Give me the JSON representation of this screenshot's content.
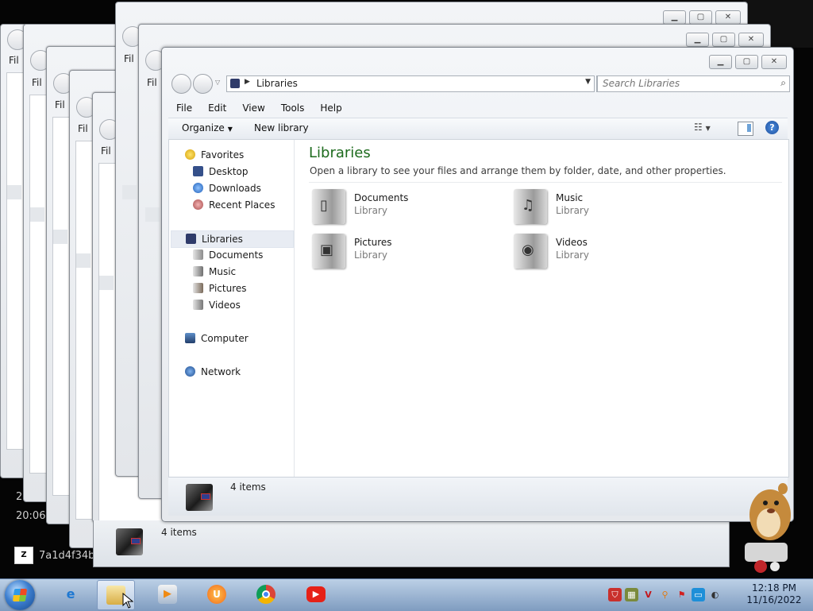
{
  "desktop": {
    "left_text_1": "2022",
    "left_text_2": "20:06",
    "shortcut_label": "7a1d4f34be",
    "shortcut_badge": "Z"
  },
  "background_windows": {
    "menu_stub": "Fil",
    "caption_min": "▁",
    "caption_max": "▢",
    "caption_close": "✕"
  },
  "window": {
    "address": "Libraries",
    "search_placeholder": "Search Libraries",
    "menu": [
      "File",
      "Edit",
      "View",
      "Tools",
      "Help"
    ],
    "toolbar": {
      "organize_label": "Organize",
      "new_library_label": "New library"
    },
    "nav": {
      "favorites": "Favorites",
      "favorites_items": [
        "Desktop",
        "Downloads",
        "Recent Places"
      ],
      "libraries": "Libraries",
      "libraries_items": [
        "Documents",
        "Music",
        "Pictures",
        "Videos"
      ],
      "computer": "Computer",
      "network": "Network"
    },
    "content": {
      "title": "Libraries",
      "subtitle": "Open a library to see your files and arrange them by folder, date, and other properties.",
      "libraries": [
        {
          "name": "Documents",
          "kind": "Library",
          "icon": "documents-library-icon"
        },
        {
          "name": "Music",
          "kind": "Library",
          "icon": "music-library-icon"
        },
        {
          "name": "Pictures",
          "kind": "Library",
          "icon": "pictures-library-icon"
        },
        {
          "name": "Videos",
          "kind": "Library",
          "icon": "videos-library-icon"
        }
      ]
    },
    "details": {
      "count": "4 items"
    }
  },
  "outer_window_details": {
    "count": "4 items"
  },
  "taskbar": {
    "clock_time": "12:18 PM",
    "clock_date": "11/16/2022",
    "pinned": [
      "internet-explorer-icon",
      "windows-explorer-icon",
      "media-player-icon",
      "uc-browser-icon",
      "chrome-icon",
      "youtube-icon"
    ]
  },
  "colors": {
    "library_title": "#1e6b1e",
    "taskbar_top": "#bcd0e6",
    "taskbar_bottom": "#7f9cc0"
  }
}
